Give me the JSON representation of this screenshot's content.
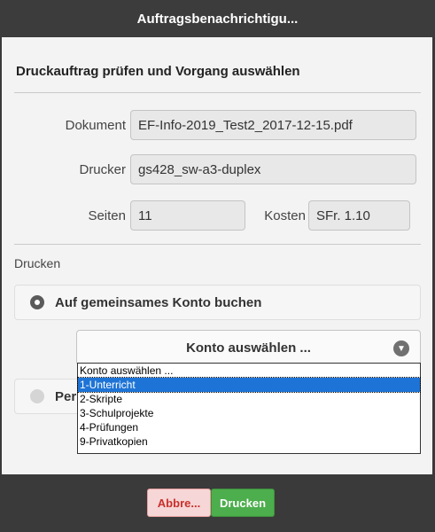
{
  "window": {
    "title": "Auftragsbenachrichtigu..."
  },
  "form": {
    "heading": "Druckauftrag prüfen und Vorgang auswählen",
    "document_label": "Dokument",
    "document_value": "EF-Info-2019_Test2_2017-12-15.pdf",
    "printer_label": "Drucker",
    "printer_value": "gs428_sw-a3-duplex",
    "pages_label": "Seiten",
    "pages_value": "11",
    "cost_label": "Kosten",
    "cost_value": "SFr. 1.10"
  },
  "print_section": {
    "label": "Drucken",
    "option_shared": "Auf gemeinsames Konto buchen",
    "option_personal_partial": "Per",
    "account_select_value": "Konto auswählen ...",
    "account_options": [
      "Konto auswählen ...",
      "1-Unterricht",
      "2-Skripte",
      "3-Schulprojekte",
      "4-Prüfungen",
      "9-Privatkopien"
    ],
    "highlighted_index": 1
  },
  "footer": {
    "cancel_label": "Abbre...",
    "print_label": "Drucken"
  },
  "colors": {
    "titlebar": "#3c3c3c",
    "highlight": "#1e74d6",
    "print_button": "#4cae4c",
    "cancel_text": "#c9302c"
  }
}
